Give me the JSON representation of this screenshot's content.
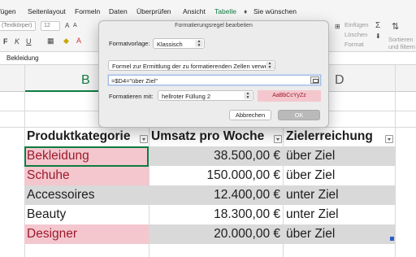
{
  "ribbon": {
    "tabs": [
      {
        "label": "Einfügen"
      },
      {
        "label": "Seitenlayout"
      },
      {
        "label": "Formeln"
      },
      {
        "label": "Daten"
      },
      {
        "label": "Überprüfen"
      },
      {
        "label": "Ansicht"
      },
      {
        "label": "Tabelle"
      }
    ],
    "tell_me": "Sie wünschen",
    "font_name": "(Textkörper)",
    "font_size": "12",
    "insert_label": "Einfügen",
    "delete_label": "Löschen",
    "format_label": "Format",
    "sort_label_1": "Sortieren",
    "sort_label_2": "und filtern"
  },
  "formula_bar": {
    "cell_value": "Bekleidung"
  },
  "columns": {
    "b": "B",
    "d": "D"
  },
  "table": {
    "headers": [
      "Produktkategorie",
      "Umsatz pro Woche",
      "Zielerreichung"
    ],
    "rows": [
      {
        "category": "Bekleidung",
        "revenue": "38.500,00 €",
        "target": "über Ziel",
        "highlight": true
      },
      {
        "category": "Schuhe",
        "revenue": "150.000,00 €",
        "target": "über Ziel",
        "highlight": true
      },
      {
        "category": "Accessoires",
        "revenue": "12.400,00 €",
        "target": "unter Ziel",
        "highlight": false
      },
      {
        "category": "Beauty",
        "revenue": "18.300,00 €",
        "target": "unter Ziel",
        "highlight": false
      },
      {
        "category": "Designer",
        "revenue": "20.000,00 €",
        "target": "über Ziel",
        "highlight": true
      }
    ]
  },
  "dialog": {
    "title": "Formatierungsregel bearbeiten",
    "style_label": "Formatvorlage:",
    "style_value": "Klassisch",
    "rule_type": "Formel zur Ermittlung der zu formatierenden Zellen verwen...",
    "formula": "=$D4=\"über Ziel\"",
    "format_with_label": "Formatieren mit:",
    "format_with_value": "hellroter Füllung 2",
    "preview_text": "AaBbCcYyZz",
    "cancel_label": "Abbrechen",
    "ok_label": "OK"
  },
  "colors": {
    "accent": "#107c41",
    "highlight_fill": "#f4c7ce",
    "highlight_text": "#9c1a2b",
    "band_fill": "#d9d9d9"
  }
}
